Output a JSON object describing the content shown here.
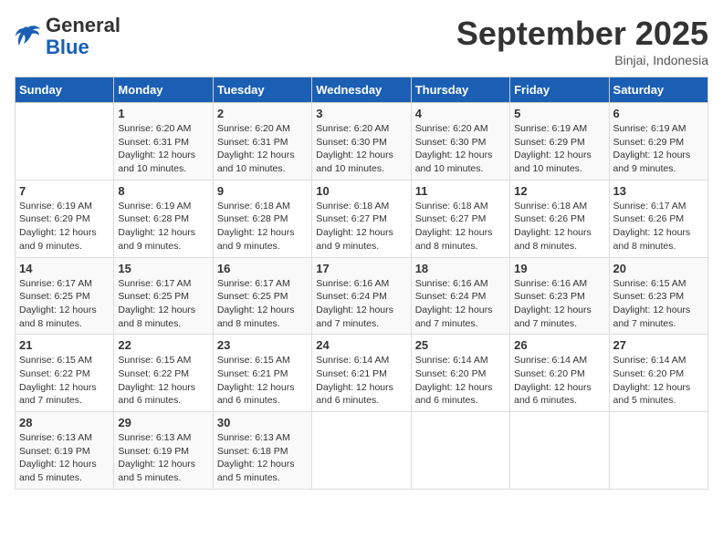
{
  "logo": {
    "text_general": "General",
    "text_blue": "Blue"
  },
  "title": "September 2025",
  "location": "Binjai, Indonesia",
  "weekdays": [
    "Sunday",
    "Monday",
    "Tuesday",
    "Wednesday",
    "Thursday",
    "Friday",
    "Saturday"
  ],
  "weeks": [
    [
      {
        "day": "",
        "info": ""
      },
      {
        "day": "1",
        "info": "Sunrise: 6:20 AM\nSunset: 6:31 PM\nDaylight: 12 hours\nand 10 minutes."
      },
      {
        "day": "2",
        "info": "Sunrise: 6:20 AM\nSunset: 6:31 PM\nDaylight: 12 hours\nand 10 minutes."
      },
      {
        "day": "3",
        "info": "Sunrise: 6:20 AM\nSunset: 6:30 PM\nDaylight: 12 hours\nand 10 minutes."
      },
      {
        "day": "4",
        "info": "Sunrise: 6:20 AM\nSunset: 6:30 PM\nDaylight: 12 hours\nand 10 minutes."
      },
      {
        "day": "5",
        "info": "Sunrise: 6:19 AM\nSunset: 6:29 PM\nDaylight: 12 hours\nand 10 minutes."
      },
      {
        "day": "6",
        "info": "Sunrise: 6:19 AM\nSunset: 6:29 PM\nDaylight: 12 hours\nand 9 minutes."
      }
    ],
    [
      {
        "day": "7",
        "info": "Sunrise: 6:19 AM\nSunset: 6:29 PM\nDaylight: 12 hours\nand 9 minutes."
      },
      {
        "day": "8",
        "info": "Sunrise: 6:19 AM\nSunset: 6:28 PM\nDaylight: 12 hours\nand 9 minutes."
      },
      {
        "day": "9",
        "info": "Sunrise: 6:18 AM\nSunset: 6:28 PM\nDaylight: 12 hours\nand 9 minutes."
      },
      {
        "day": "10",
        "info": "Sunrise: 6:18 AM\nSunset: 6:27 PM\nDaylight: 12 hours\nand 9 minutes."
      },
      {
        "day": "11",
        "info": "Sunrise: 6:18 AM\nSunset: 6:27 PM\nDaylight: 12 hours\nand 8 minutes."
      },
      {
        "day": "12",
        "info": "Sunrise: 6:18 AM\nSunset: 6:26 PM\nDaylight: 12 hours\nand 8 minutes."
      },
      {
        "day": "13",
        "info": "Sunrise: 6:17 AM\nSunset: 6:26 PM\nDaylight: 12 hours\nand 8 minutes."
      }
    ],
    [
      {
        "day": "14",
        "info": "Sunrise: 6:17 AM\nSunset: 6:25 PM\nDaylight: 12 hours\nand 8 minutes."
      },
      {
        "day": "15",
        "info": "Sunrise: 6:17 AM\nSunset: 6:25 PM\nDaylight: 12 hours\nand 8 minutes."
      },
      {
        "day": "16",
        "info": "Sunrise: 6:17 AM\nSunset: 6:25 PM\nDaylight: 12 hours\nand 8 minutes."
      },
      {
        "day": "17",
        "info": "Sunrise: 6:16 AM\nSunset: 6:24 PM\nDaylight: 12 hours\nand 7 minutes."
      },
      {
        "day": "18",
        "info": "Sunrise: 6:16 AM\nSunset: 6:24 PM\nDaylight: 12 hours\nand 7 minutes."
      },
      {
        "day": "19",
        "info": "Sunrise: 6:16 AM\nSunset: 6:23 PM\nDaylight: 12 hours\nand 7 minutes."
      },
      {
        "day": "20",
        "info": "Sunrise: 6:15 AM\nSunset: 6:23 PM\nDaylight: 12 hours\nand 7 minutes."
      }
    ],
    [
      {
        "day": "21",
        "info": "Sunrise: 6:15 AM\nSunset: 6:22 PM\nDaylight: 12 hours\nand 7 minutes."
      },
      {
        "day": "22",
        "info": "Sunrise: 6:15 AM\nSunset: 6:22 PM\nDaylight: 12 hours\nand 6 minutes."
      },
      {
        "day": "23",
        "info": "Sunrise: 6:15 AM\nSunset: 6:21 PM\nDaylight: 12 hours\nand 6 minutes."
      },
      {
        "day": "24",
        "info": "Sunrise: 6:14 AM\nSunset: 6:21 PM\nDaylight: 12 hours\nand 6 minutes."
      },
      {
        "day": "25",
        "info": "Sunrise: 6:14 AM\nSunset: 6:20 PM\nDaylight: 12 hours\nand 6 minutes."
      },
      {
        "day": "26",
        "info": "Sunrise: 6:14 AM\nSunset: 6:20 PM\nDaylight: 12 hours\nand 6 minutes."
      },
      {
        "day": "27",
        "info": "Sunrise: 6:14 AM\nSunset: 6:20 PM\nDaylight: 12 hours\nand 5 minutes."
      }
    ],
    [
      {
        "day": "28",
        "info": "Sunrise: 6:13 AM\nSunset: 6:19 PM\nDaylight: 12 hours\nand 5 minutes."
      },
      {
        "day": "29",
        "info": "Sunrise: 6:13 AM\nSunset: 6:19 PM\nDaylight: 12 hours\nand 5 minutes."
      },
      {
        "day": "30",
        "info": "Sunrise: 6:13 AM\nSunset: 6:18 PM\nDaylight: 12 hours\nand 5 minutes."
      },
      {
        "day": "",
        "info": ""
      },
      {
        "day": "",
        "info": ""
      },
      {
        "day": "",
        "info": ""
      },
      {
        "day": "",
        "info": ""
      }
    ]
  ]
}
